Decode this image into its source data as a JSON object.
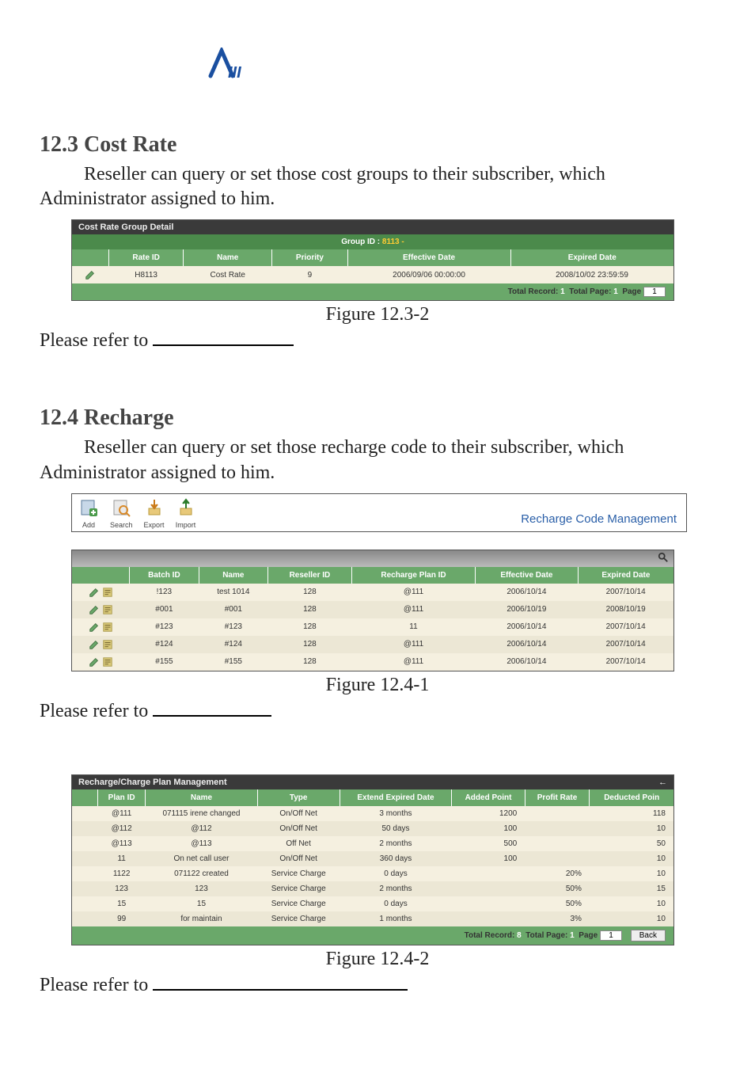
{
  "logo_alt": "logo",
  "section_12_3": {
    "heading": "12.3 Cost Rate",
    "paragraph": "Reseller can query or set those cost groups to their subscriber, which Administrator assigned to him.",
    "figure_caption": "Figure 12.3-2",
    "refer_text": "Please refer to ",
    "screenshot": {
      "title_bar": "Cost Rate Group Detail",
      "group_label": "Group ID : ",
      "group_value": "8113 - ",
      "columns": [
        "",
        "Rate ID",
        "Name",
        "Priority",
        "Effective Date",
        "Expired Date"
      ],
      "row": {
        "rate_id": "H8113",
        "name": "Cost Rate",
        "priority": "9",
        "effective": "2006/09/06 00:00:00",
        "expired": "2008/10/02 23:59:59"
      },
      "footer": {
        "total_record_label": "Total Record:",
        "total_record_value": "1",
        "total_page_label": "Total Page:",
        "total_page_value": "1",
        "page_label": "Page",
        "page_value": "1"
      }
    }
  },
  "section_12_4": {
    "heading": "12.4 Recharge",
    "paragraph": "Reseller can query or set those recharge code to their subscriber, which Administrator assigned to him.",
    "figure1_caption": "Figure 12.4-1",
    "figure2_caption": "Figure 12.4-2",
    "refer_text": "Please refer to ",
    "toolbar": {
      "items": [
        "Add",
        "Search",
        "Export",
        "Import"
      ],
      "title": "Recharge Code Management"
    },
    "code_table": {
      "columns": [
        "",
        "Batch ID",
        "Name",
        "Reseller ID",
        "Recharge Plan ID",
        "Effective Date",
        "Expired Date"
      ],
      "rows": [
        {
          "batch": "!123",
          "name": "test 1014",
          "reseller": "128",
          "plan": "@111",
          "eff": "2006/10/14",
          "exp": "2007/10/14"
        },
        {
          "batch": "#001",
          "name": "#001",
          "reseller": "128",
          "plan": "@111",
          "eff": "2006/10/19",
          "exp": "2008/10/19"
        },
        {
          "batch": "#123",
          "name": "#123",
          "reseller": "128",
          "plan": "11",
          "eff": "2006/10/14",
          "exp": "2007/10/14"
        },
        {
          "batch": "#124",
          "name": "#124",
          "reseller": "128",
          "plan": "@111",
          "eff": "2006/10/14",
          "exp": "2007/10/14"
        },
        {
          "batch": "#155",
          "name": "#155",
          "reseller": "128",
          "plan": "@111",
          "eff": "2006/10/14",
          "exp": "2007/10/14"
        }
      ]
    },
    "plan_table": {
      "title_bar": "Recharge/Charge Plan Management",
      "columns": [
        "",
        "Plan ID",
        "Name",
        "Type",
        "Extend Expired Date",
        "Added Point",
        "Profit Rate",
        "Deducted Poin"
      ],
      "rows": [
        {
          "plan": "@111",
          "name": "071115 irene changed",
          "type": "On/Off Net",
          "ext": "3 months",
          "added": "1200",
          "profit": "",
          "deduct": "118"
        },
        {
          "plan": "@112",
          "name": "@112",
          "type": "On/Off Net",
          "ext": "50 days",
          "added": "100",
          "profit": "",
          "deduct": "10"
        },
        {
          "plan": "@113",
          "name": "@113",
          "type": "Off Net",
          "ext": "2 months",
          "added": "500",
          "profit": "",
          "deduct": "50"
        },
        {
          "plan": "11",
          "name": "On net call user",
          "type": "On/Off Net",
          "ext": "360 days",
          "added": "100",
          "profit": "",
          "deduct": "10"
        },
        {
          "plan": "1122",
          "name": "071122 created",
          "type": "Service Charge",
          "ext": "0 days",
          "added": "",
          "profit": "20%",
          "deduct": "10"
        },
        {
          "plan": "123",
          "name": "123",
          "type": "Service Charge",
          "ext": "2 months",
          "added": "",
          "profit": "50%",
          "deduct": "15"
        },
        {
          "plan": "15",
          "name": "15",
          "type": "Service Charge",
          "ext": "0 days",
          "added": "",
          "profit": "50%",
          "deduct": "10"
        },
        {
          "plan": "99",
          "name": "for maintain",
          "type": "Service Charge",
          "ext": "1 months",
          "added": "",
          "profit": "3%",
          "deduct": "10"
        }
      ],
      "footer": {
        "total_record_label": "Total Record:",
        "total_record_value": "8",
        "total_page_label": "Total Page:",
        "total_page_value": "1",
        "page_label": "Page",
        "page_value": "1",
        "back_label": "Back"
      }
    }
  }
}
